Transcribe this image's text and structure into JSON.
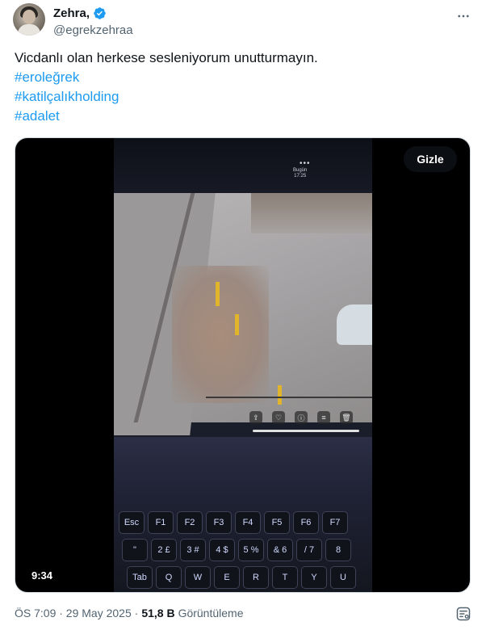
{
  "author": {
    "display_name": "Zehra,",
    "handle": "@egrekzehraa",
    "verified": true
  },
  "tweet": {
    "text_line": "Vicdanlı olan herkese sesleniyorum unutturmayın.",
    "hashtags": [
      "#eroleğrek",
      "#katilçalıkholding",
      "#adalet"
    ]
  },
  "media": {
    "hide_label": "Gizle",
    "duration": "9:34",
    "phone_date_top": "Bugün",
    "phone_date_bottom": "17:25"
  },
  "footer": {
    "timestamp": "ÖS 7:09 · 29 May 2025 · ",
    "views_count": "51,8 B",
    "views_label": " Görüntüleme"
  },
  "keyboard": {
    "row1": [
      "Esc",
      "F1",
      "F2",
      "F3",
      "F4",
      "F5",
      "F6",
      "F7"
    ],
    "row2": [
      "\"",
      "2 £",
      "3 #",
      "4 $",
      "5 %",
      "& 6",
      "/ 7",
      "8"
    ],
    "row3": [
      "Tab",
      "Q",
      "W",
      "E",
      "R",
      "T",
      "Y",
      "U"
    ]
  },
  "colors": {
    "accent": "#1d9bf0",
    "text_primary": "#0f1419",
    "text_secondary": "#536471"
  },
  "icons": {
    "more": "more-horizontal-icon",
    "verified": "verified-badge-icon",
    "grok": "grok-icon"
  }
}
